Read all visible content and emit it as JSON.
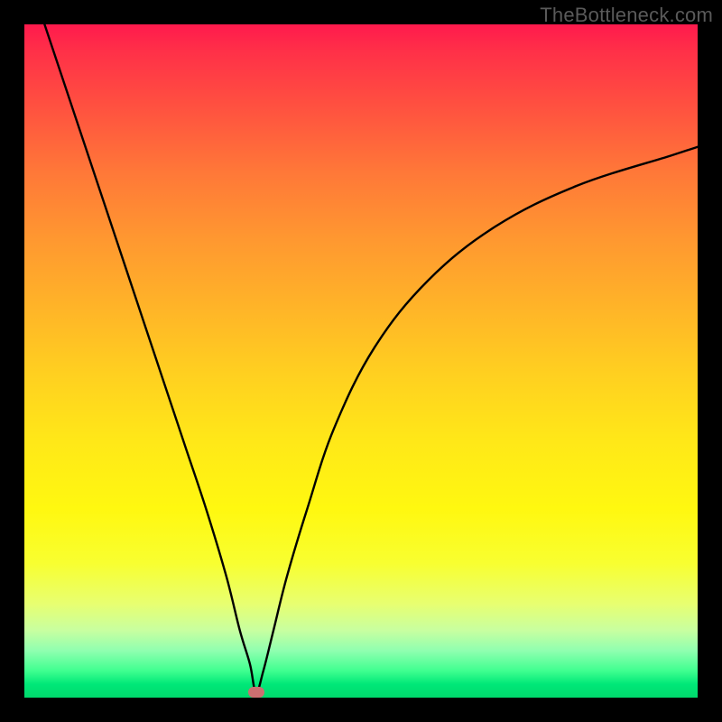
{
  "watermark": "TheBottleneck.com",
  "chart_data": {
    "type": "line",
    "title": "",
    "xlabel": "",
    "ylabel": "",
    "xlim": [
      0,
      100
    ],
    "ylim": [
      0,
      100
    ],
    "series": [
      {
        "name": "bottleneck-curve",
        "x": [
          3,
          6,
          9,
          12,
          15,
          18,
          21,
          24,
          27,
          30,
          32,
          33.5,
          34.4,
          35.5,
          37,
          39,
          42,
          46,
          52,
          60,
          70,
          82,
          96,
          100
        ],
        "y": [
          100,
          91,
          82,
          73,
          64,
          55,
          46,
          37,
          28,
          18,
          10,
          5,
          0.8,
          4,
          10,
          18,
          28,
          40,
          52,
          62,
          70,
          76,
          80.5,
          81.8
        ]
      }
    ],
    "marker": {
      "x": 34.4,
      "y": 0.8,
      "color": "#cc6f70"
    },
    "background_gradient": {
      "top": "#ff1a4d",
      "mid": "#ffe818",
      "bottom": "#00d86c"
    }
  }
}
